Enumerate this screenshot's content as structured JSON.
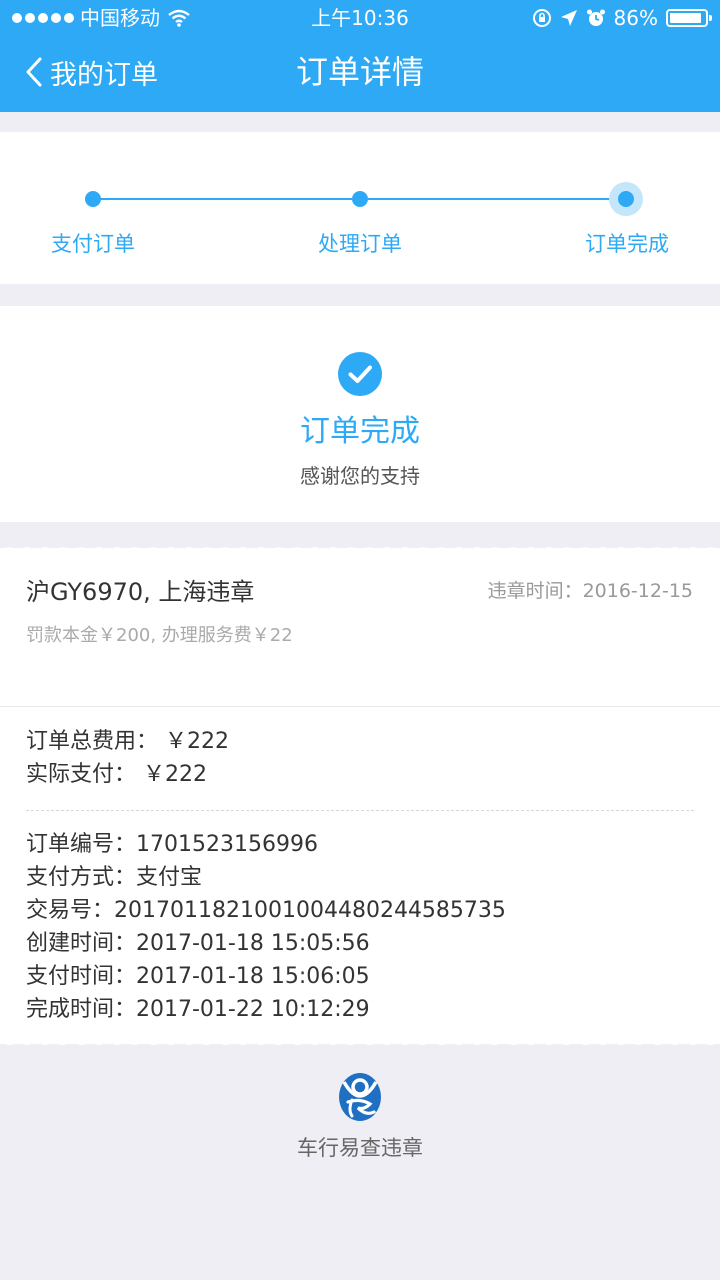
{
  "status_bar": {
    "carrier": "中国移动",
    "time": "上午10:36",
    "battery": "86%",
    "battery_level": 0.86
  },
  "nav": {
    "back_label": "我的订单",
    "title": "订单详情"
  },
  "progress": {
    "steps": [
      {
        "label": "支付订单"
      },
      {
        "label": "处理订单"
      },
      {
        "label": "订单完成"
      }
    ],
    "current_step": 3
  },
  "status": {
    "title": "订单完成",
    "subtitle": "感谢您的支持"
  },
  "violation": {
    "plate_location": "沪GY6970, 上海违章",
    "time_label": "违章时间：2016-12-15",
    "fees": "罚款本金￥200, 办理服务费￥22"
  },
  "payment": {
    "total": "订单总费用： ￥222",
    "actual": "实际支付： ￥222"
  },
  "order_info": [
    "订单编号：1701523156996",
    "支付方式：支付宝",
    "交易号：2017011821001004480244585735",
    "创建时间：2017-01-18 15:05:56",
    "支付时间：2017-01-18 15:06:05",
    "完成时间：2017-01-22 10:12:29"
  ],
  "footer": {
    "brand": "车行易查违章"
  },
  "colors": {
    "accent": "#2ea9f5",
    "background": "#eeeef4"
  }
}
